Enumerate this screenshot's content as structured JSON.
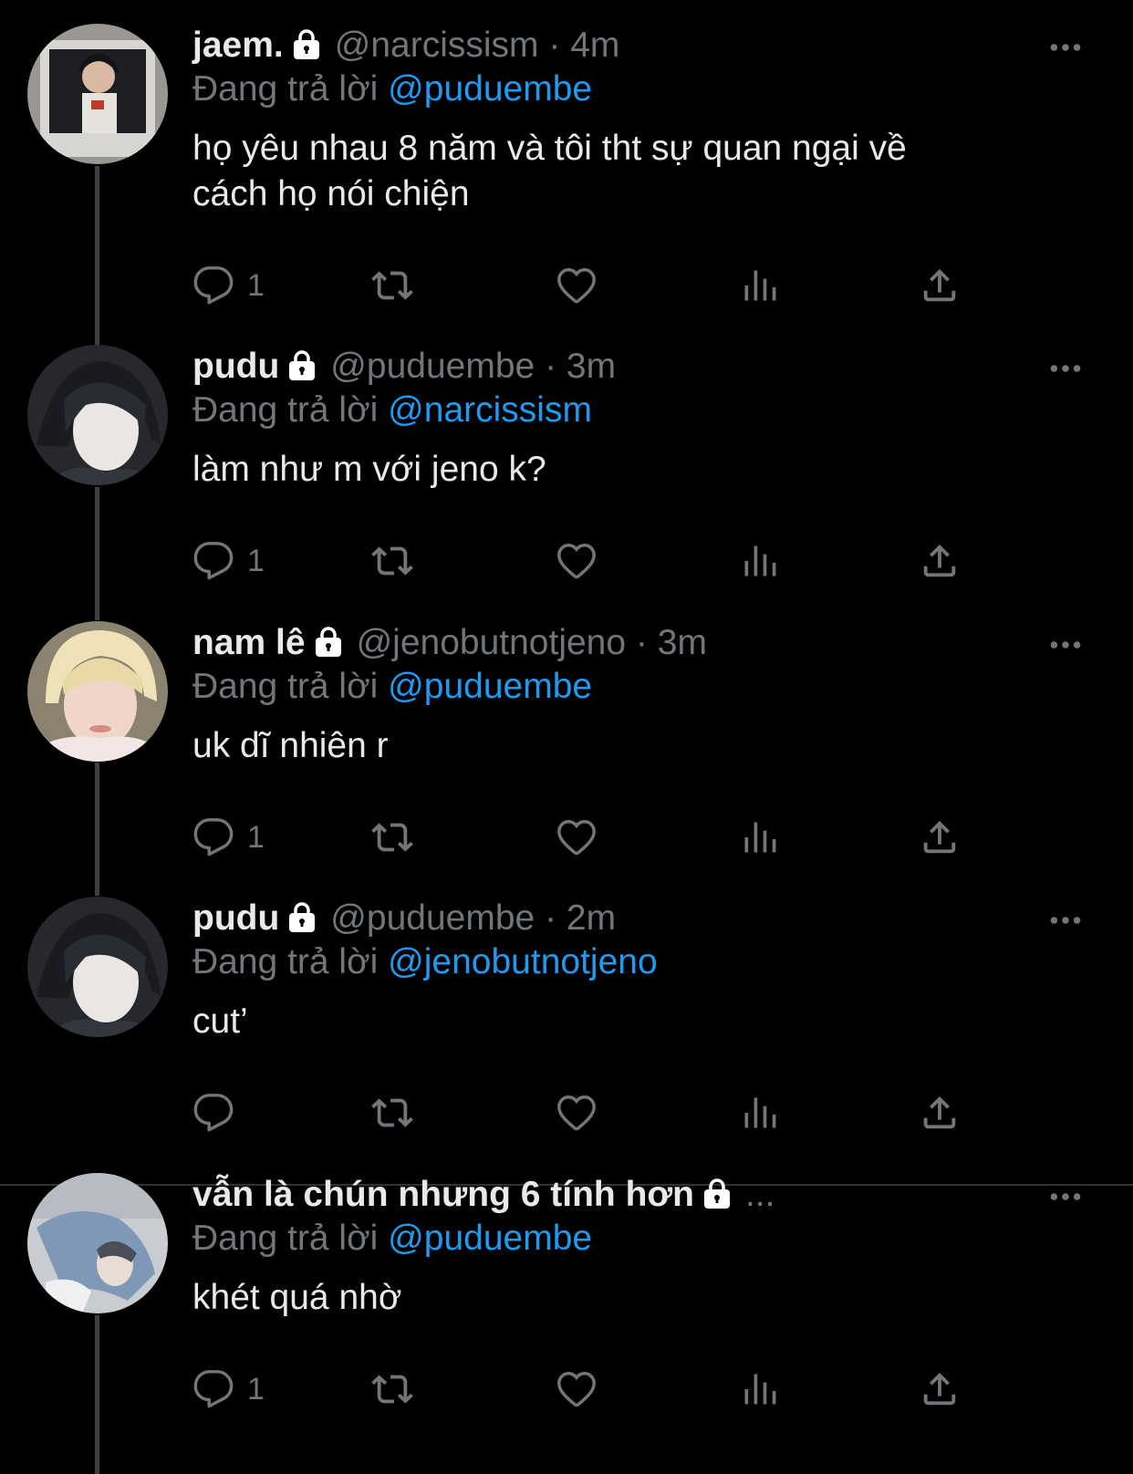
{
  "tweets": [
    {
      "name": "jaem.",
      "handle": "@narcissism",
      "dot": "·",
      "time": "4m",
      "reply_label": "Đang trả lời",
      "reply_to": "@puduembe",
      "text": "họ yêu nhau 8 năm và tôi tht sự quan ngại về\ncách họ nói chiện",
      "replies": "1"
    },
    {
      "name": "pudu",
      "handle": "@puduembe",
      "dot": "·",
      "time": "3m",
      "reply_label": "Đang trả lời",
      "reply_to": "@narcissism",
      "text": "làm như m với jeno k?",
      "replies": "1"
    },
    {
      "name": "nam lê",
      "handle": "@jenobutnotjeno",
      "dot": "·",
      "time": "3m",
      "reply_label": "Đang trả lời",
      "reply_to": "@puduembe",
      "text": "uk dĩ nhiên r",
      "replies": "1"
    },
    {
      "name": "pudu",
      "handle": "@puduembe",
      "dot": "·",
      "time": "2m",
      "reply_label": "Đang trả lời",
      "reply_to": "@jenobutnotjeno",
      "text": "cut’",
      "replies": ""
    },
    {
      "name": "vẫn là chún nhưng 6 tính hơn",
      "handle": "...",
      "dot": "",
      "time": "",
      "reply_label": "Đang trả lời",
      "reply_to": "@puduembe",
      "text": "khét quá nhờ",
      "replies": "1"
    }
  ],
  "icons": {
    "reply": "reply-icon",
    "retweet": "retweet-icon",
    "like": "heart-icon",
    "views": "views-icon",
    "share": "share-icon",
    "more": "more-icon",
    "lock": "lock-icon"
  },
  "colors": {
    "background": "#000000",
    "text": "#e7e9ea",
    "muted": "#71767b",
    "link": "#1d9bf0",
    "thread": "#3e4144"
  }
}
